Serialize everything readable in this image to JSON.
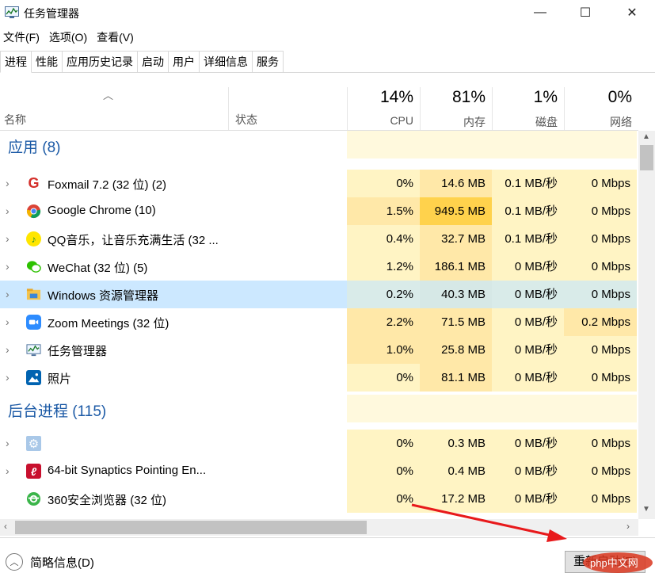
{
  "window": {
    "title": "任务管理器",
    "minimize_glyph": "—",
    "maximize_glyph": "☐",
    "close_glyph": "✕"
  },
  "menu": [
    "文件(F)",
    "选项(O)",
    "查看(V)"
  ],
  "tabs": [
    "进程",
    "性能",
    "应用历史记录",
    "启动",
    "用户",
    "详细信息",
    "服务"
  ],
  "header": {
    "name": "名称",
    "status": "状态",
    "cpu_pct": "14%",
    "cpu": "CPU",
    "mem_pct": "81%",
    "mem": "内存",
    "disk_pct": "1%",
    "disk": "磁盘",
    "net_pct": "0%",
    "net": "网络"
  },
  "groups": {
    "apps": "应用 (8)",
    "background": "后台进程 (115)"
  },
  "apps": [
    {
      "name": "Foxmail 7.2 (32 位) (2)",
      "icon": "foxmail-icon",
      "cpu": "0%",
      "mem": "14.6 MB",
      "disk": "0.1 MB/秒",
      "net": "0 Mbps"
    },
    {
      "name": "Google Chrome (10)",
      "icon": "chrome-icon",
      "cpu": "1.5%",
      "mem": "949.5 MB",
      "disk": "0.1 MB/秒",
      "net": "0 Mbps"
    },
    {
      "name": "QQ音乐，让音乐充满生活 (32 ...",
      "icon": "qqmusic-icon",
      "cpu": "0.4%",
      "mem": "32.7 MB",
      "disk": "0.1 MB/秒",
      "net": "0 Mbps"
    },
    {
      "name": "WeChat (32 位) (5)",
      "icon": "wechat-icon",
      "cpu": "1.2%",
      "mem": "186.1 MB",
      "disk": "0 MB/秒",
      "net": "0 Mbps"
    },
    {
      "name": "Windows 资源管理器",
      "icon": "explorer-icon",
      "cpu": "0.2%",
      "mem": "40.3 MB",
      "disk": "0 MB/秒",
      "net": "0 Mbps"
    },
    {
      "name": "Zoom Meetings (32 位)",
      "icon": "zoom-icon",
      "cpu": "2.2%",
      "mem": "71.5 MB",
      "disk": "0 MB/秒",
      "net": "0.2 Mbps"
    },
    {
      "name": "任务管理器",
      "icon": "task-manager-icon",
      "cpu": "1.0%",
      "mem": "25.8 MB",
      "disk": "0 MB/秒",
      "net": "0 Mbps"
    },
    {
      "name": "照片",
      "icon": "photos-icon",
      "cpu": "0%",
      "mem": "81.1 MB",
      "disk": "0 MB/秒",
      "net": "0 Mbps"
    }
  ],
  "background": [
    {
      "name": "",
      "icon": "settings-gear-icon",
      "cpu": "0%",
      "mem": "0.3 MB",
      "disk": "0 MB/秒",
      "net": "0 Mbps"
    },
    {
      "name": "64-bit Synaptics Pointing En...",
      "icon": "synaptics-icon",
      "cpu": "0%",
      "mem": "0.4 MB",
      "disk": "0 MB/秒",
      "net": "0 Mbps"
    },
    {
      "name": "360安全浏览器 (32 位)",
      "icon": "browser-360-icon",
      "cpu": "0%",
      "mem": "17.2 MB",
      "disk": "0 MB/秒",
      "net": "0 Mbps"
    }
  ],
  "footer": {
    "fewer_details": "简略信息(D)",
    "restart": "重新启动(E)"
  },
  "watermark": "php中文网"
}
